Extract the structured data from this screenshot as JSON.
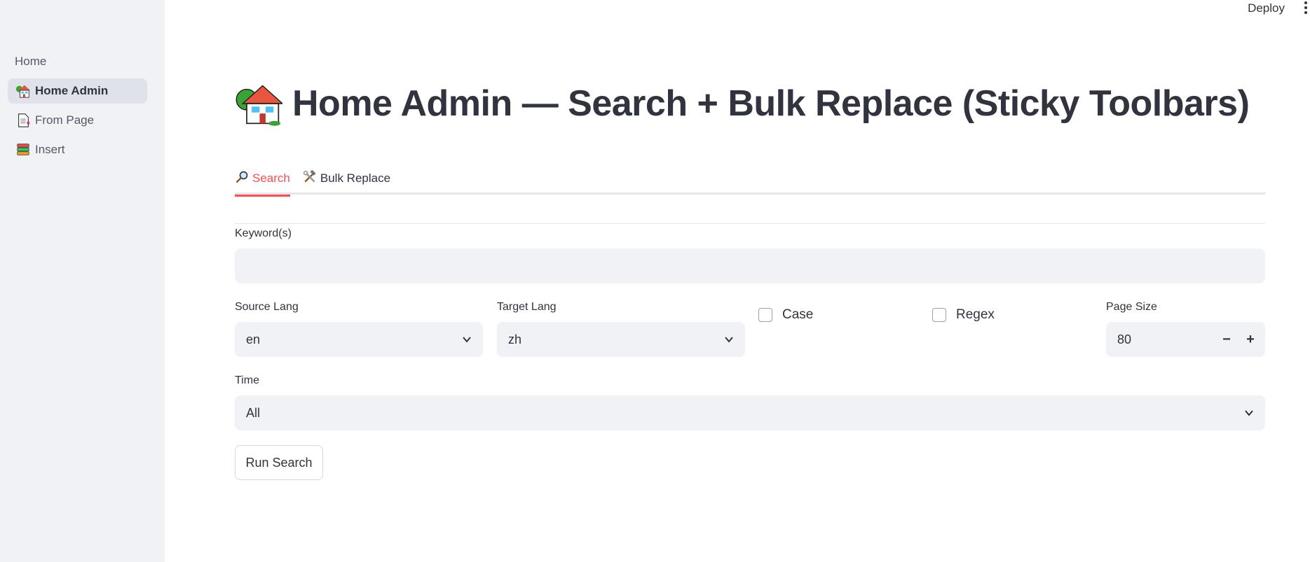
{
  "header": {
    "deploy_label": "Deploy"
  },
  "sidebar": {
    "root_label": "Home",
    "items": [
      {
        "label": "Home Admin",
        "icon": "house-with-garden-icon",
        "active": true
      },
      {
        "label": "From Page",
        "icon": "page-icon",
        "active": false
      },
      {
        "label": "Insert",
        "icon": "books-icon",
        "active": false
      }
    ]
  },
  "page": {
    "title": "Home Admin — Search + Bulk Replace (Sticky Toolbars)",
    "title_icon": "house-with-garden-icon"
  },
  "tabs": [
    {
      "label": "Search",
      "icon": "magnifier-icon",
      "active": true
    },
    {
      "label": "Bulk Replace",
      "icon": "hammer-wrench-icon",
      "active": false
    }
  ],
  "form": {
    "keyword_label": "Keyword(s)",
    "keyword_value": "",
    "source_lang_label": "Source Lang",
    "source_lang_value": "en",
    "target_lang_label": "Target Lang",
    "target_lang_value": "zh",
    "case_label": "Case",
    "case_checked": false,
    "regex_label": "Regex",
    "regex_checked": false,
    "page_size_label": "Page Size",
    "page_size_value": "80",
    "minus_label": "−",
    "plus_label": "+",
    "time_label": "Time",
    "time_value": "All",
    "run_label": "Run Search"
  },
  "colors": {
    "accent": "#ff4b4b",
    "sidebar_bg": "#f0f2f6",
    "input_bg": "#f0f2f6",
    "text": "#31333f"
  }
}
